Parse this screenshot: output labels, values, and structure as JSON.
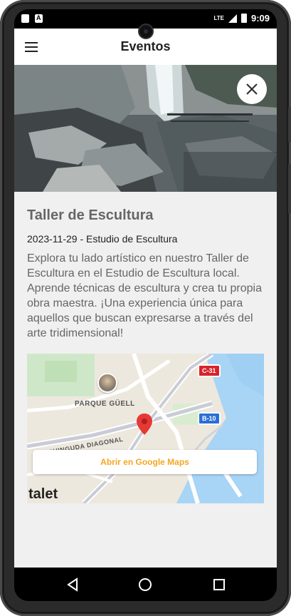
{
  "status_bar": {
    "time": "9:09",
    "network": "LTE",
    "left_icons": [
      "sd-card-icon",
      "a-badge-icon"
    ],
    "right_icons": [
      "lte-icon",
      "signal-icon",
      "battery-charging-icon"
    ]
  },
  "app_bar": {
    "title": "Eventos",
    "menu_icon": "hamburger-menu-icon"
  },
  "event": {
    "image_alt": "waterfall-rocks-photo",
    "close_icon": "close-icon",
    "title": "Taller de Escultura",
    "meta": "2023-11-29 - Estudio de Escultura",
    "description": "Explora tu lado artístico en nuestro Taller de Escultura en el Estudio de Escultura local. Aprende técnicas de escultura y crea tu propia obra maestra. ¡Una experiencia única para aquellos que buscan expresarse a través del arte tridimensional!"
  },
  "map": {
    "labels": {
      "park": "PARQUE GÜELL",
      "avenue": "AVINGUDA DIAGONAL",
      "partial_city": "talet"
    },
    "badges": [
      "C-31",
      "B-10"
    ],
    "badge_colors": {
      "C-31": "#d8232a",
      "B-10": "#2a6fd6"
    },
    "open_button": "Abrir en Google Maps",
    "accent_color": "#f5a623"
  },
  "nav_bar": {
    "buttons": [
      "back-triangle-icon",
      "home-circle-icon",
      "recents-square-icon"
    ]
  }
}
